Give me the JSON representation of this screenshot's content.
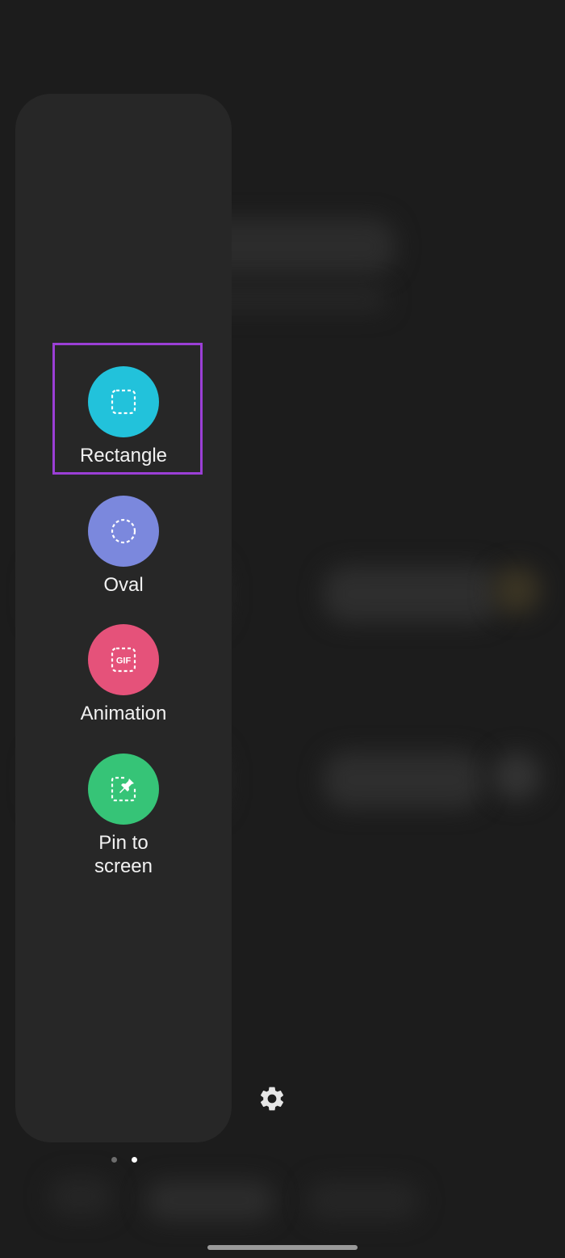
{
  "tools": [
    {
      "id": "rectangle",
      "label": "Rectangle",
      "color": "#22c2db",
      "icon": "dashed-rectangle-icon"
    },
    {
      "id": "oval",
      "label": "Oval",
      "color": "#7b88dd",
      "icon": "dashed-circle-icon"
    },
    {
      "id": "animation",
      "label": "Animation",
      "color": "#e5527a",
      "icon": "gif-icon",
      "icon_text": "GIF"
    },
    {
      "id": "pin",
      "label": "Pin to\nscreen",
      "color": "#36c477",
      "icon": "pin-icon"
    }
  ],
  "selected_tool": "rectangle",
  "highlight_color": "#9b3fd6",
  "settings_icon": "gear-icon",
  "page_indicator": {
    "count": 2,
    "active": 2
  }
}
